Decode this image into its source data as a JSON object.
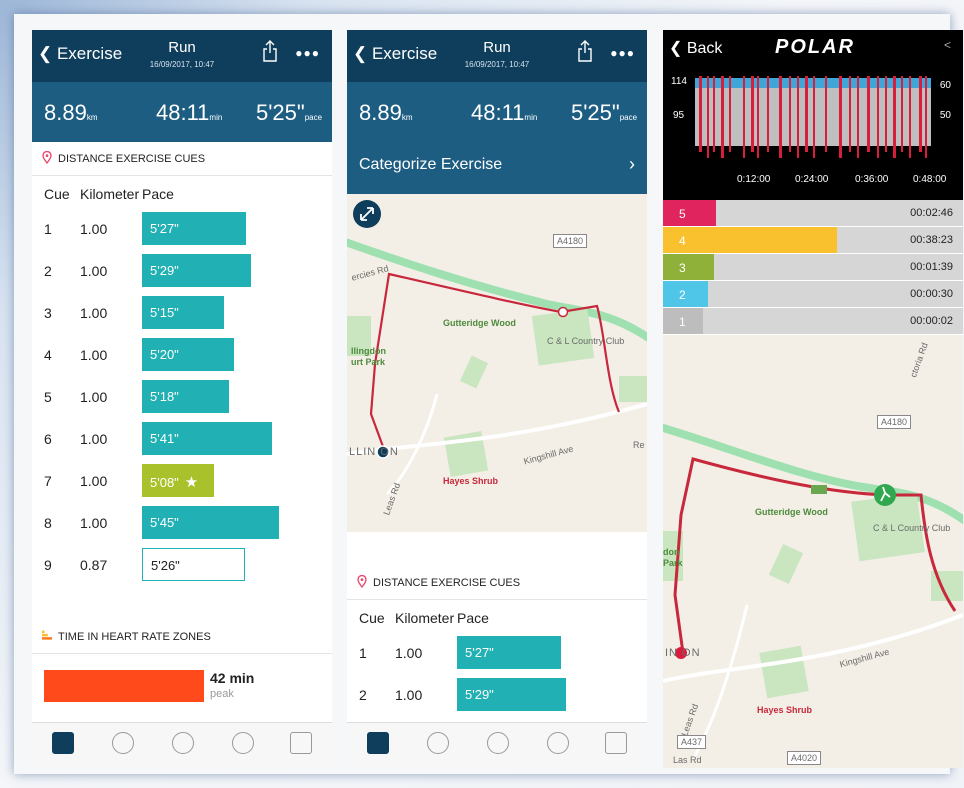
{
  "screen1": {
    "back_label": "Exercise",
    "title": "Run",
    "subtitle": "16/09/2017, 10:47",
    "stats": [
      {
        "value": "8.89",
        "unit": "km"
      },
      {
        "value": "48:11",
        "unit": "min"
      },
      {
        "value": "5'25\"",
        "unit": "pace"
      }
    ],
    "section_title": "DISTANCE EXERCISE CUES",
    "columns": [
      "Cue",
      "Kilometer",
      "Pace"
    ],
    "cues": [
      {
        "cue": "1",
        "km": "1.00",
        "pace": "5'27\"",
        "fill": 0.8,
        "style": "normal"
      },
      {
        "cue": "2",
        "km": "1.00",
        "pace": "5'29\"",
        "fill": 0.84,
        "style": "normal"
      },
      {
        "cue": "3",
        "km": "1.00",
        "pace": "5'15\"",
        "fill": 0.63,
        "style": "normal"
      },
      {
        "cue": "4",
        "km": "1.00",
        "pace": "5'20\"",
        "fill": 0.71,
        "style": "normal"
      },
      {
        "cue": "5",
        "km": "1.00",
        "pace": "5'18\"",
        "fill": 0.67,
        "style": "normal"
      },
      {
        "cue": "6",
        "km": "1.00",
        "pace": "5'41\"",
        "fill": 1.0,
        "style": "normal"
      },
      {
        "cue": "7",
        "km": "1.00",
        "pace": "5'08\"",
        "fill": 0.55,
        "style": "best"
      },
      {
        "cue": "8",
        "km": "1.00",
        "pace": "5'45\"",
        "fill": 1.05,
        "style": "normal"
      },
      {
        "cue": "9",
        "km": "0.87",
        "pace": "5'26\"",
        "fill": 0.79,
        "style": "outline"
      }
    ],
    "hr_section_title": "TIME IN HEART RATE ZONES",
    "hr_value": "42 min",
    "hr_label": "peak"
  },
  "screen2": {
    "back_label": "Exercise",
    "title": "Run",
    "subtitle": "16/09/2017, 10:47",
    "stats": [
      {
        "value": "8.89",
        "unit": "km"
      },
      {
        "value": "48:11",
        "unit": "min"
      },
      {
        "value": "5'25\"",
        "unit": "pace"
      }
    ],
    "categorize_label": "Categorize Exercise",
    "map_labels": {
      "road_a4180": "A4180",
      "gutteridge": "Gutteridge Wood",
      "country_club": "C & L Country Club",
      "park": "llingdon urt Park",
      "ercies": "ercies Rd",
      "llin": "LLIN ON",
      "hayes": "Hayes Shrub",
      "kingshill": "Kingshill Ave",
      "leas": "Leas Rd",
      "re": "Re"
    },
    "section_title": "DISTANCE EXERCISE CUES",
    "columns": [
      "Cue",
      "Kilometer",
      "Pace"
    ],
    "cues": [
      {
        "cue": "1",
        "km": "1.00",
        "pace": "5'27\"",
        "fill": 0.8
      },
      {
        "cue": "2",
        "km": "1.00",
        "pace": "5'29\"",
        "fill": 0.84
      }
    ]
  },
  "screen3": {
    "back_label": "Back",
    "logo_text": "POLAR",
    "hr_chart": {
      "left_ticks": [
        "114",
        "95"
      ],
      "right_ticks": [
        "60",
        "50"
      ],
      "x_ticks": [
        "0:12:00",
        "0:24:00",
        "0:36:00",
        "0:48:00"
      ]
    },
    "zones": [
      {
        "zone": "5",
        "time": "00:02:46",
        "color": "#e0245e",
        "fill": 0.08
      },
      {
        "zone": "4",
        "time": "00:38:23",
        "color": "#f9c12e",
        "fill": 0.84
      },
      {
        "zone": "3",
        "time": "00:01:39",
        "color": "#8fb13a",
        "fill": 0.07
      },
      {
        "zone": "2",
        "time": "00:00:30",
        "color": "#4fc6e8",
        "fill": 0.03
      },
      {
        "zone": "1",
        "time": "00:00:02",
        "color": "#bdbdbd",
        "fill": 0.0
      }
    ],
    "map_labels": {
      "road_a4180": "A4180",
      "gutteridge": "Gutteridge Wood",
      "country_club": "C & L Country Club",
      "victoria": "ctoria Rd",
      "hayes": "Hayes Shrub",
      "kingshill": "Kingshill Ave",
      "inon": "IN ON",
      "don": "don Park",
      "leas": "Leas Rd",
      "a437": "A437",
      "a4020": "A4020",
      "las": "Las Rd"
    }
  },
  "colors": {
    "header": "#0f3e5c",
    "stats": "#1d5d82",
    "teal": "#21b0b4",
    "best": "#a9c22b",
    "route": "#c8283c",
    "polar_red": "#d81e3c"
  }
}
